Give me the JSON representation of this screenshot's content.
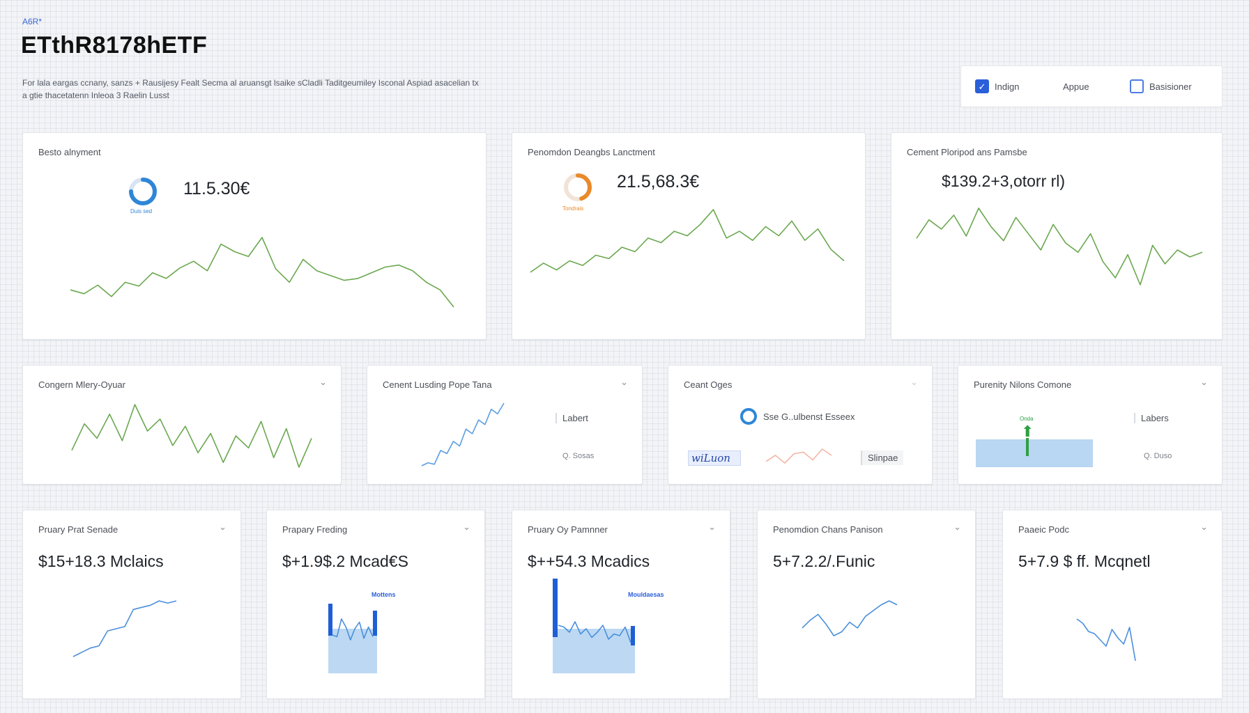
{
  "header": {
    "eyebrow": "A6R*",
    "title": "ETthR8178hETF",
    "description": "For lala eargas ccnany, sanzs + Rausijesy Fealt Secma al aruansgt lsaike sCladli Taditgeumiley Isconal Aspiad asacelian tx a gtie thacetatenn Inleoa 3 Raelin Lusst"
  },
  "toolbar": {
    "items": [
      {
        "label": "Indign",
        "checked": true
      },
      {
        "label": "Appue"
      },
      {
        "label": "Basisioner",
        "checked": false
      }
    ]
  },
  "row1": [
    {
      "title": "Besto alnyment",
      "value": "11.5.30€",
      "gauge_label": "Duis sed",
      "gauge_color": "#2f86d6",
      "gauge_fraction": 0.75
    },
    {
      "title": "Penomdon Deangbs Lanctment",
      "value": "21.5,68.3€",
      "gauge_label": "Tondrais",
      "gauge_color": "#e98a2a",
      "gauge_fraction": 0.45
    },
    {
      "title": "Cement Ploripod ans Pamsbe",
      "value": "$139.2+3,otorr rl)"
    }
  ],
  "row2": [
    {
      "title": "Congern Mlery-Oyuar"
    },
    {
      "title": "Cenent Lusding Pope Tana",
      "label": "Labert",
      "sub": "Q. Sosas"
    },
    {
      "title": "Ceant Oges",
      "label": "Sse G..ulbenst Esseex",
      "button": "Slinpae",
      "signature": "wiLuon"
    },
    {
      "title": "Purenity Nilons Comone",
      "label": "Labers",
      "sub": "Q. Duso",
      "marker": "Onda"
    }
  ],
  "row3": [
    {
      "title": "Pruary Prat Senade",
      "value": "$15+18.3 Mclaics"
    },
    {
      "title": "Prapary Freding",
      "value": "$+1.9$.2 Mcad€S",
      "legend": "Mottens"
    },
    {
      "title": "Pruary Oy Pamnner",
      "value": "$++54.3 Mcadics",
      "legend": "Mouldaesas"
    },
    {
      "title": "Penomdion Chans Panison",
      "value": "5+7.2.2/.Funic"
    },
    {
      "title": "Paaeic Podc",
      "value": "5+7.9 $ ff. Mcqnetl"
    }
  ],
  "chart_data": [
    {
      "type": "line",
      "series": [
        {
          "values": [
            40,
            36,
            45,
            33,
            48,
            44,
            58,
            52,
            63,
            70,
            60,
            88,
            80,
            75,
            95,
            62,
            48,
            72,
            60,
            55,
            50,
            52,
            58,
            64,
            66,
            60,
            48,
            40,
            22
          ]
        }
      ]
    },
    {
      "type": "line",
      "series": [
        {
          "values": [
            30,
            38,
            32,
            40,
            36,
            45,
            42,
            52,
            48,
            60,
            56,
            66,
            62,
            72,
            85,
            60,
            66,
            58,
            70,
            62,
            75,
            58,
            68,
            50,
            40
          ]
        }
      ]
    },
    {
      "type": "line",
      "series": [
        {
          "values": [
            70,
            86,
            78,
            90,
            72,
            96,
            80,
            68,
            88,
            74,
            60,
            82,
            66,
            58,
            74,
            50,
            36,
            56,
            30,
            64,
            48,
            60,
            54,
            58
          ]
        }
      ]
    },
    {
      "type": "line",
      "series": [
        {
          "values": [
            50,
            72,
            60,
            80,
            58,
            88,
            66,
            76,
            54,
            70,
            48,
            64,
            40,
            62,
            52,
            74,
            44,
            68,
            36,
            60
          ]
        }
      ]
    },
    {
      "type": "line",
      "series": [
        {
          "values": [
            10,
            14,
            12,
            30,
            26,
            42,
            36,
            58,
            52,
            70,
            64,
            84,
            78,
            92
          ]
        }
      ]
    },
    {
      "type": "line",
      "series": [
        {
          "values": [
            28,
            36,
            26,
            38,
            40,
            30,
            44,
            36
          ]
        }
      ]
    },
    {
      "type": "line",
      "series": [
        {
          "values": [
            20,
            24,
            28,
            30,
            44,
            46,
            48,
            64,
            66,
            68,
            72,
            70,
            72
          ]
        }
      ]
    },
    {
      "type": "line",
      "series": [
        {
          "values": [
            50,
            48,
            70,
            60,
            44,
            58,
            66,
            46,
            60,
            48
          ]
        }
      ]
    },
    {
      "type": "line",
      "series": [
        {
          "values": [
            60,
            58,
            52,
            64,
            50,
            56,
            46,
            52,
            60,
            44,
            50,
            48,
            58,
            40
          ]
        }
      ]
    },
    {
      "type": "line",
      "series": [
        {
          "values": [
            56,
            64,
            70,
            60,
            48,
            52,
            62,
            56,
            68,
            74,
            80,
            84,
            80
          ]
        }
      ]
    },
    {
      "type": "line",
      "series": [
        {
          "values": [
            70,
            66,
            58,
            56,
            50,
            44,
            60,
            52,
            46,
            62,
            30
          ]
        }
      ]
    }
  ]
}
